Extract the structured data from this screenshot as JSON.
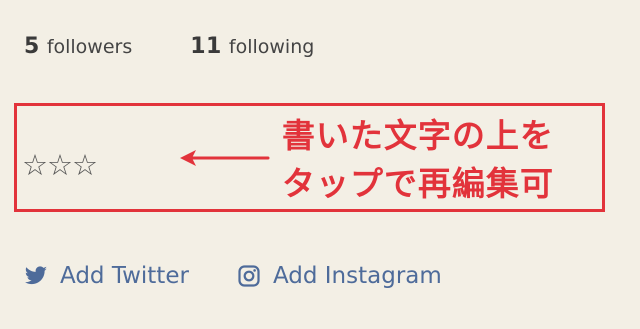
{
  "profile": {
    "followers": {
      "count": "5",
      "label": "followers"
    },
    "following": {
      "count": "11",
      "label": "following"
    }
  },
  "bio": {
    "stars": "☆☆☆"
  },
  "annotation": {
    "line1": "書いた文字の上を",
    "line2": "タップで再編集可",
    "color": "#e2333b"
  },
  "social": {
    "twitter_label": "Add Twitter",
    "instagram_label": "Add Instagram",
    "link_color": "#4e6b9a"
  },
  "colors": {
    "background": "#f3efe5",
    "text": "#3a3a3a"
  }
}
